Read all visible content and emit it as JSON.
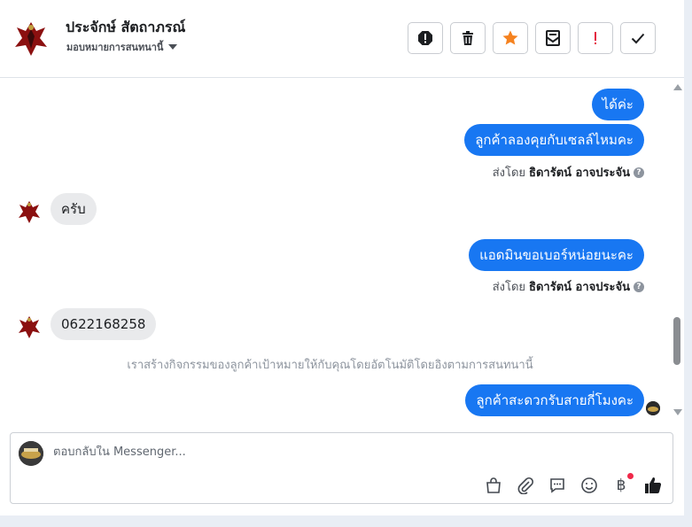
{
  "header": {
    "contact_name": "ประจักษ์ สัตถาภรณ์",
    "assignment_label": "มอบหมายการสนทนานี้",
    "toolbar": [
      "mark-spam",
      "delete",
      "star",
      "mark-unread",
      "follow-up",
      "done"
    ],
    "colors": {
      "star": "#f5821f",
      "follow_up": "#e41e3f"
    }
  },
  "messages": [
    {
      "dir": "out",
      "text": "ได้ค่ะ"
    },
    {
      "dir": "out",
      "text": "ลูกค้าลองคุยกับเซลล์ไหมคะ"
    },
    {
      "dir": "meta",
      "prefix": "ส่งโดย",
      "sender": "ธิดารัตน์ อาจประจัน"
    },
    {
      "dir": "in",
      "text": "ครับ"
    },
    {
      "dir": "out",
      "text": "แอดมินขอเบอร์หน่อยนะคะ"
    },
    {
      "dir": "meta",
      "prefix": "ส่งโดย",
      "sender": "ธิดารัตน์ อาจประจัน"
    },
    {
      "dir": "in",
      "text": "0622168258"
    },
    {
      "dir": "system",
      "text": "เราสร้างกิจกรรมของลูกค้าเป้าหมายให้กับคุณโดยอัตโนมัติโดยอิงตามการสนทนานี้"
    },
    {
      "dir": "out",
      "text": "ลูกค้าสะดวกรับสายกี่โมงคะ"
    }
  ],
  "composer": {
    "placeholder": "ตอบกลับใน Messenger...",
    "value": "",
    "icons": [
      "shopping-bag",
      "attachment",
      "saved-replies",
      "emoji",
      "payment",
      "like"
    ],
    "currency_symbol": "฿"
  },
  "colors": {
    "brand": "#1877f2",
    "incoming_bubble": "#e9eaec"
  }
}
